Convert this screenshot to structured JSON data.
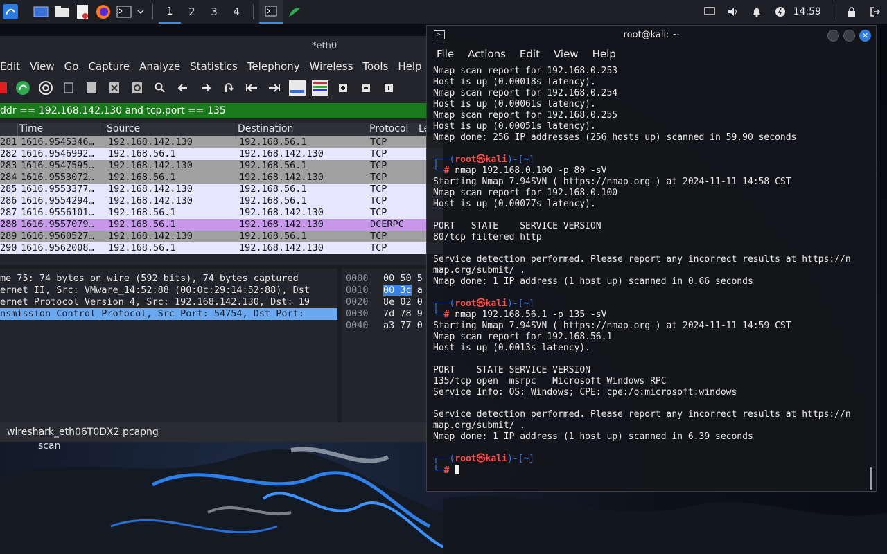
{
  "taskbar": {
    "workspaces": [
      "1",
      "2",
      "3",
      "4"
    ],
    "clock": "14:59",
    "icons": [
      "kali-menu-icon",
      "show-desktop-icon",
      "file-manager-icon",
      "text-editor-icon",
      "firefox-icon",
      "terminal-icon",
      "dropdown-icon",
      "terminal-task-icon",
      "wireshark-task-icon",
      "screen-icon",
      "volume-icon",
      "notification-bell-icon",
      "power-icon",
      "lock-icon",
      "logout-icon"
    ]
  },
  "wireshark": {
    "title": "*eth0",
    "menu": [
      "Edit",
      "View",
      "Go",
      "Capture",
      "Analyze",
      "Statistics",
      "Telephony",
      "Wireless",
      "Tools",
      "Help"
    ],
    "filter": "ddr == 192.168.142.130 and tcp.port == 135",
    "columns": [
      "Time",
      "Source",
      "Destination",
      "Protocol",
      "Le"
    ],
    "packets": [
      {
        "no": "281",
        "time": "1616.9545346…",
        "src": "192.168.142.130",
        "dst": "192.168.56.1",
        "proto": "TCP",
        "color": "gray"
      },
      {
        "no": "282",
        "time": "1616.9546992…",
        "src": "192.168.56.1",
        "dst": "192.168.142.130",
        "proto": "TCP",
        "color": "lav"
      },
      {
        "no": "283",
        "time": "1616.9547595…",
        "src": "192.168.142.130",
        "dst": "192.168.56.1",
        "proto": "TCP",
        "color": "gray"
      },
      {
        "no": "284",
        "time": "1616.9553072…",
        "src": "192.168.56.1",
        "dst": "192.168.142.130",
        "proto": "TCP",
        "color": "gray"
      },
      {
        "no": "285",
        "time": "1616.9553377…",
        "src": "192.168.142.130",
        "dst": "192.168.56.1",
        "proto": "TCP",
        "color": "lav"
      },
      {
        "no": "286",
        "time": "1616.9554294…",
        "src": "192.168.142.130",
        "dst": "192.168.56.1",
        "proto": "TCP",
        "color": "lav"
      },
      {
        "no": "287",
        "time": "1616.9556101…",
        "src": "192.168.56.1",
        "dst": "192.168.142.130",
        "proto": "TCP",
        "color": "lav"
      },
      {
        "no": "288",
        "time": "1616.9557079…",
        "src": "192.168.56.1",
        "dst": "192.168.142.130",
        "proto": "DCERPC",
        "color": "purple"
      },
      {
        "no": "289",
        "time": "1616.9560527…",
        "src": "192.168.142.130",
        "dst": "192.168.56.1",
        "proto": "TCP",
        "color": "gray"
      },
      {
        "no": "290",
        "time": "1616.9562008…",
        "src": "192.168.56.1",
        "dst": "192.168.142.130",
        "proto": "TCP",
        "color": "lav"
      }
    ],
    "details": [
      "me 75: 74 bytes on wire (592 bits), 74 bytes captured",
      "ernet II, Src: VMware_14:52:88 (00:0c:29:14:52:88), Dst",
      "ernet Protocol Version 4, Src: 192.168.142.130, Dst: 19",
      "nsmission Control Protocol, Src Port: 54754, Dst Port:"
    ],
    "bytes": [
      {
        "offset": "0000",
        "hex": "00 50 5"
      },
      {
        "offset": "0010",
        "hex_hl": "00 3c",
        "hex": " a"
      },
      {
        "offset": "0020",
        "hex": "8e 02 0"
      },
      {
        "offset": "0030",
        "hex": "7d 78 9"
      },
      {
        "offset": "0040",
        "hex": "a3 77 0"
      }
    ],
    "status_file": "wireshark_eth06T0DX2.pcapng"
  },
  "desktop": {
    "scan_label": "scan"
  },
  "terminal": {
    "title": "root@kali: ~",
    "menu": [
      "File",
      "Actions",
      "Edit",
      "View",
      "Help"
    ],
    "prompt_user": "root",
    "prompt_at": "㉿",
    "prompt_host": "kali",
    "prompt_dir": "~",
    "lines_block1": [
      "Nmap scan report for 192.168.0.253",
      "Host is up (0.00018s latency).",
      "Nmap scan report for 192.168.0.254",
      "Host is up (0.00061s latency).",
      "Nmap scan report for 192.168.0.255",
      "Host is up (0.00051s latency).",
      "Nmap done: 256 IP addresses (256 hosts up) scanned in 59.90 seconds"
    ],
    "cmd2": {
      "base": "nmap 192.168.0.100 ",
      "flags": "-p 80 -sV"
    },
    "lines_block2": [
      "Starting Nmap 7.94SVN ( https://nmap.org ) at 2024-11-11 14:58 CST",
      "Nmap scan report for 192.168.0.100",
      "Host is up (0.00077s latency).",
      "",
      "PORT   STATE    SERVICE VERSION",
      "80/tcp filtered http",
      "",
      "Service detection performed. Please report any incorrect results at https://n",
      "map.org/submit/ .",
      "Nmap done: 1 IP address (1 host up) scanned in 0.66 seconds"
    ],
    "cmd3": {
      "base": "nmap 192.168.56.1 ",
      "flags": "-p 135 -sV"
    },
    "lines_block3": [
      "Starting Nmap 7.94SVN ( https://nmap.org ) at 2024-11-11 14:59 CST",
      "Nmap scan report for 192.168.56.1",
      "Host is up (0.0013s latency).",
      "",
      "PORT    STATE SERVICE VERSION",
      "135/tcp open  msrpc   Microsoft Windows RPC",
      "Service Info: OS: Windows; CPE: cpe:/o:microsoft:windows",
      "",
      "Service detection performed. Please report any incorrect results at https://n",
      "map.org/submit/ .",
      "Nmap done: 1 IP address (1 host up) scanned in 6.39 seconds"
    ]
  }
}
